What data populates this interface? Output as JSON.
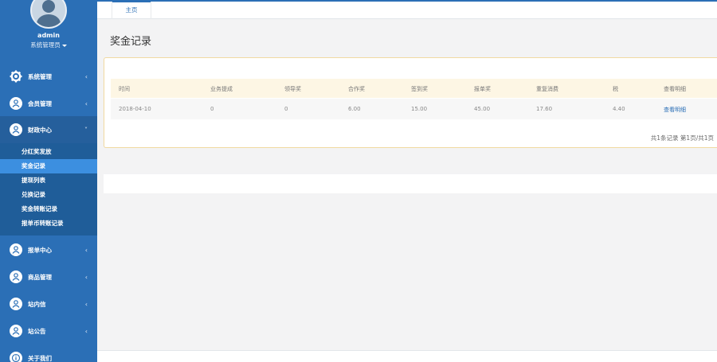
{
  "profile": {
    "name": "admin",
    "role": "系统管理员"
  },
  "nav": [
    {
      "label": "系统管理",
      "icon": "gear-icon",
      "chevron": "‹"
    },
    {
      "label": "会员管理",
      "icon": "user-icon",
      "chevron": "‹"
    },
    {
      "label": "财政中心",
      "icon": "user-icon",
      "chevron": "˅"
    },
    {
      "label": "报单中心",
      "icon": "user-icon",
      "chevron": "‹"
    },
    {
      "label": "商品管理",
      "icon": "user-icon",
      "chevron": "‹"
    },
    {
      "label": "站内信",
      "icon": "user-icon",
      "chevron": "‹"
    },
    {
      "label": "站公告",
      "icon": "user-icon",
      "chevron": "‹"
    },
    {
      "label": "关于我们",
      "icon": "info-icon",
      "chevron": ""
    }
  ],
  "submenu": [
    "分红奖发放",
    "奖金记录",
    "提现列表",
    "兑换记录",
    "奖金转账记录",
    "报单币转账记录"
  ],
  "tabs": {
    "home": "主页"
  },
  "page": {
    "title": "奖金记录"
  },
  "table": {
    "headers": [
      "时间",
      "业务提成",
      "领导奖",
      "合作奖",
      "签到奖",
      "报单奖",
      "重复消费",
      "税",
      "查看明细"
    ],
    "rows": [
      [
        "2018-04-10",
        "0",
        "0",
        "6.00",
        "15.00",
        "45.00",
        "17.60",
        "4.40",
        "查看明细"
      ]
    ]
  },
  "pagination": {
    "summary": "共1条记录 第1页/共1页"
  },
  "colors": {
    "sidebar": "#2b6fb6",
    "submenu": "#1f5d99",
    "active": "#3c8fe0",
    "table_header": "#fdf6e4",
    "panel_border": "#f1d9a1"
  }
}
